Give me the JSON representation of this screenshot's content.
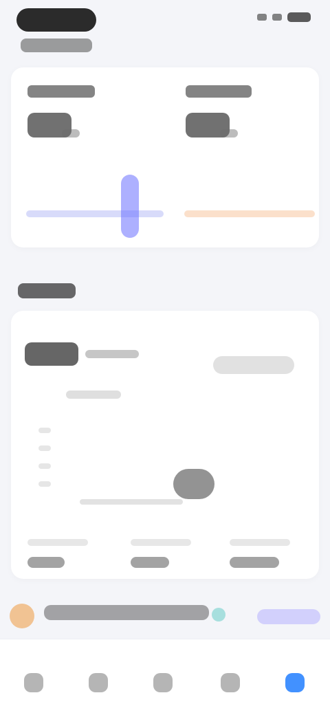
{
  "ui": {
    "colors": {
      "accent_blue": "#2e85ff",
      "spark_blue": "#6a70ff",
      "spark_orange": "#f3a66a",
      "badge_orange": "#f0b170",
      "badge_teal": "#86d6d3",
      "badge_purple": "#b7b1ff"
    },
    "bottom_nav": {
      "items": [
        {
          "icon": "home-icon"
        },
        {
          "icon": "list-icon"
        },
        {
          "icon": "message-icon"
        },
        {
          "icon": "grid-icon"
        },
        {
          "icon": "profile-icon"
        }
      ],
      "active_index": 4
    }
  }
}
